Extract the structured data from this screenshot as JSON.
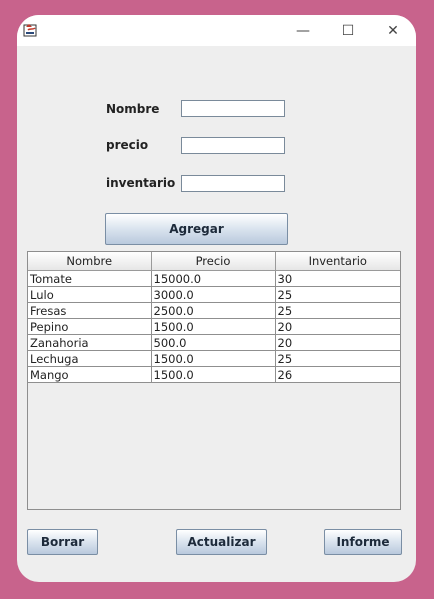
{
  "window": {
    "controls": {
      "minimize": "—",
      "maximize": "☐",
      "close": "✕"
    }
  },
  "form": {
    "fields": [
      {
        "label": "Nombre",
        "value": ""
      },
      {
        "label": "precio",
        "value": ""
      },
      {
        "label": "inventario",
        "value": ""
      }
    ],
    "add_button": "Agregar"
  },
  "table": {
    "headers": [
      "Nombre",
      "Precio",
      "Inventario"
    ],
    "rows": [
      [
        "Tomate",
        "15000.0",
        "30"
      ],
      [
        "Lulo",
        "3000.0",
        "25"
      ],
      [
        "Fresas",
        "2500.0",
        "25"
      ],
      [
        "Pepino",
        "1500.0",
        "20"
      ],
      [
        "Zanahoria",
        "500.0",
        "20"
      ],
      [
        "Lechuga",
        "1500.0",
        "25"
      ],
      [
        "Mango",
        "1500.0",
        "26"
      ]
    ]
  },
  "buttons": {
    "delete": "Borrar",
    "update": "Actualizar",
    "report": "Informe"
  }
}
